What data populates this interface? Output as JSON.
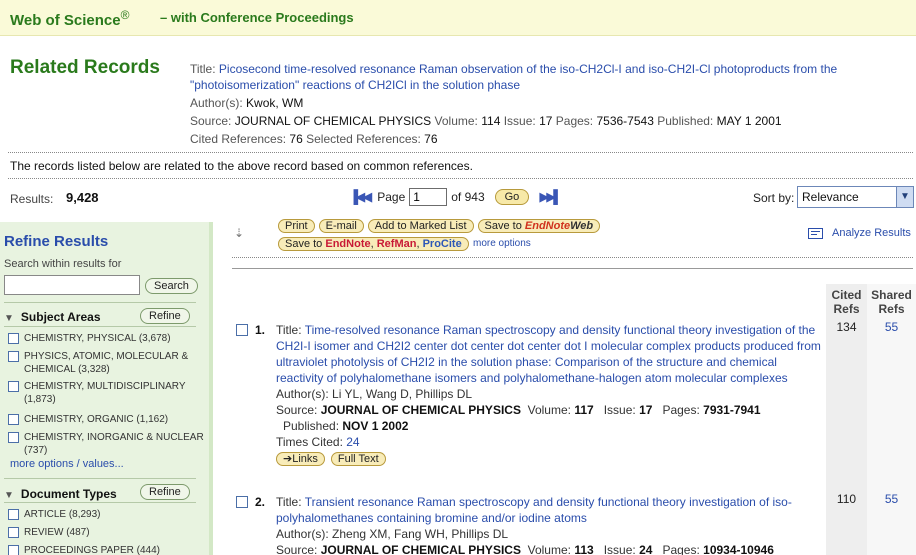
{
  "header": {
    "brand": "Web of Science",
    "reg": "®",
    "sub": "– with Conference Proceedings"
  },
  "page_title": "Related Records",
  "record": {
    "title_label": "Title:",
    "title": "Picosecond time-resolved resonance Raman observation of the iso-CH2Cl-I and iso-CH2I-Cl photoproducts from the \"photoisomerization\" reactions of CH2ICl in the solution phase",
    "authors_label": "Author(s):",
    "authors": "Kwok, WM",
    "source_label": "Source:",
    "source": "JOURNAL OF CHEMICAL PHYSICS",
    "volume_label": "Volume:",
    "volume": "114",
    "issue_label": "Issue:",
    "issue": "17",
    "pages_label": "Pages:",
    "pages": "7536-7543",
    "published_label": "Published:",
    "published": "MAY 1 2001",
    "cited_label": "Cited References:",
    "cited": "76",
    "selected_label": "Selected References:",
    "selected": "76"
  },
  "explain": "The records listed below are related to the above record based on common references.",
  "results": {
    "label": "Results:",
    "count": "9,428"
  },
  "pager": {
    "page_label": "Page",
    "page_value": "1",
    "of_text": "of 943",
    "go": "Go"
  },
  "sort": {
    "label": "Sort by:",
    "selected": "Relevance"
  },
  "sidebar": {
    "title": "Refine Results",
    "search_label": "Search within results for",
    "search_placeholder": "",
    "search_button": "Search",
    "subject": {
      "title": "Subject Areas",
      "refine": "Refine",
      "items": [
        "CHEMISTRY, PHYSICAL (3,678)",
        "PHYSICS, ATOMIC, MOLECULAR & CHEMICAL (3,328)",
        "CHEMISTRY, MULTIDISCIPLINARY (1,873)",
        "CHEMISTRY, ORGANIC (1,162)",
        "CHEMISTRY, INORGANIC & NUCLEAR (737)"
      ],
      "more": "more options / values..."
    },
    "doctypes": {
      "title": "Document Types",
      "refine": "Refine",
      "items": [
        "ARTICLE (8,293)",
        "REVIEW (487)",
        "PROCEEDINGS PAPER (444)"
      ]
    }
  },
  "toolbar": {
    "print": "Print",
    "email": "E-mail",
    "marked": "Add to Marked List",
    "save_to": "Save to",
    "en_a": "EndNote",
    "en_b": "Web",
    "save_to2": "Save to",
    "en2": "EndNote",
    "sep1": ",",
    "refman": "RefMan",
    "sep2": ",",
    "procite": "ProCite",
    "more": "more options",
    "analyze": "Analyze Results"
  },
  "columns": {
    "cited_1": "Cited",
    "cited_2": "Refs",
    "shared_1": "Shared",
    "shared_2": "Refs"
  },
  "records": [
    {
      "num": "1.",
      "title_label": "Title:",
      "title": "Time-resolved resonance Raman spectroscopy and density functional theory investigation of the CH2I-I isomer and CH2I2 center dot center dot center dot I molecular complex products produced from ultraviolet photolysis of CH2I2 in the solution phase: Comparison of the structure and chemical reactivity of polyhalomethane isomers and polyhalomethane-halogen atom molecular complexes",
      "authors_label": "Author(s):",
      "authors": "Li YL, Wang D, Phillips DL",
      "source_label": "Source:",
      "source": "JOURNAL OF CHEMICAL PHYSICS",
      "volume_label": "Volume:",
      "volume": "117",
      "issue_label": "Issue:",
      "issue": "17",
      "pages_label": "Pages:",
      "pages": "7931-7941",
      "published_label": "Published:",
      "published": "NOV 1 2002",
      "times_cited_label": "Times Cited:",
      "times_cited": "24",
      "links": "Links",
      "fulltext": "Full Text",
      "cited_refs": "134",
      "shared_refs": "55"
    },
    {
      "num": "2.",
      "title_label": "Title:",
      "title": "Transient resonance Raman spectroscopy and density functional theory investigation of iso-polyhalomethanes containing bromine and/or iodine atoms",
      "authors_label": "Author(s):",
      "authors": "Zheng XM, Fang WH, Phillips DL",
      "source_label": "Source:",
      "source": "JOURNAL OF CHEMICAL PHYSICS",
      "volume_label": "Volume:",
      "volume": "113",
      "issue_label": "Issue:",
      "issue": "24",
      "pages_label": "Pages:",
      "pages": "10934-10946",
      "cited_refs": "110",
      "shared_refs": "55"
    }
  ]
}
